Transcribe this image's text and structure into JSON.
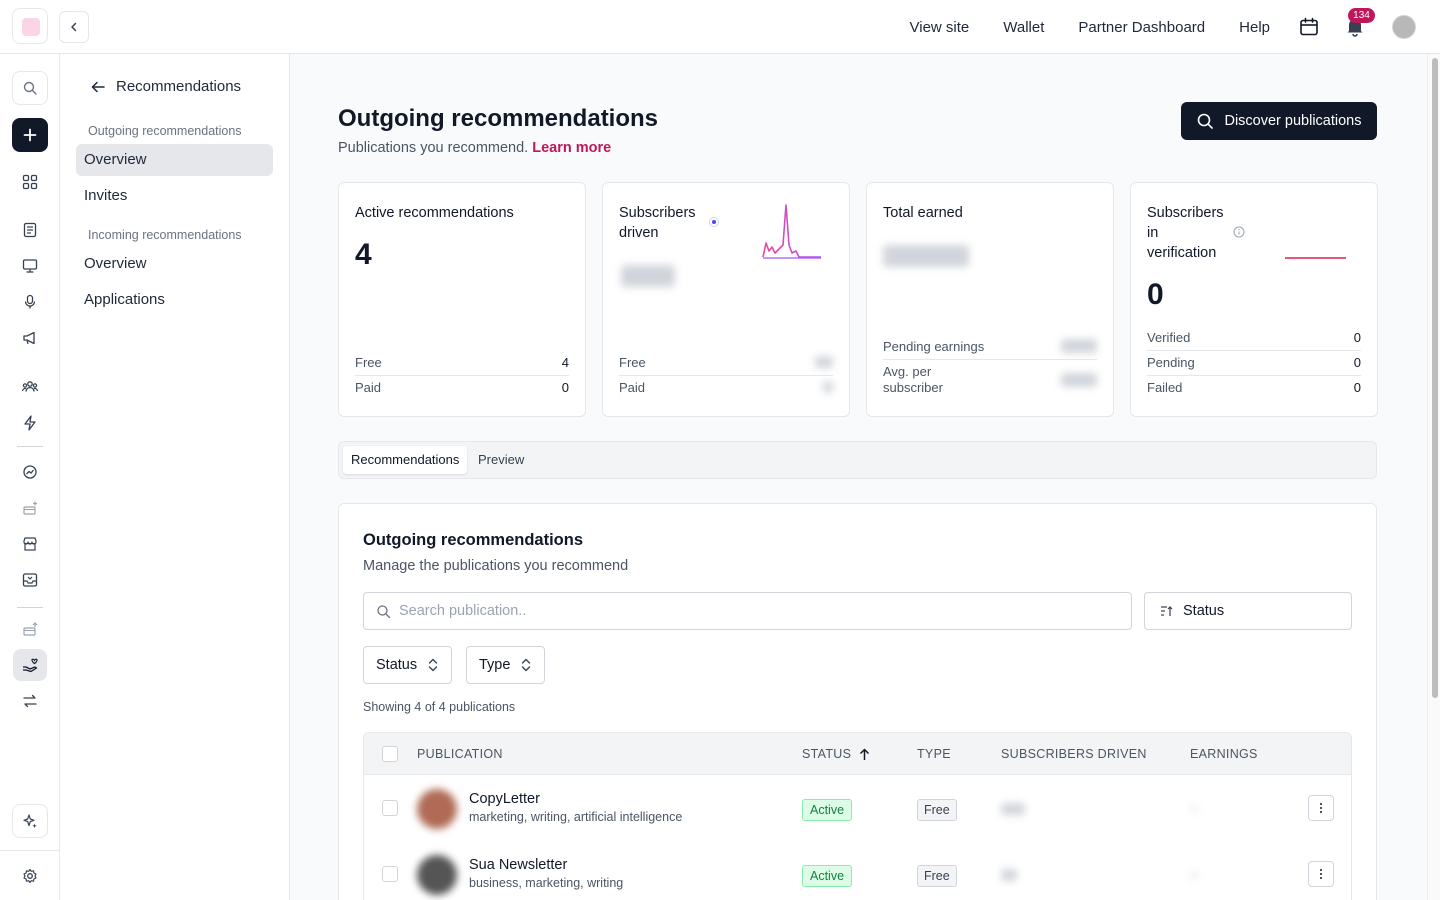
{
  "topbar": {
    "nav": [
      "View site",
      "Wallet",
      "Partner Dashboard",
      "Help"
    ],
    "notification_count": "134"
  },
  "subnav": {
    "back_label": "Recommendations",
    "outgoing_group": "Outgoing recommendations",
    "outgoing_items": [
      "Overview",
      "Invites"
    ],
    "incoming_group": "Incoming recommendations",
    "incoming_items": [
      "Overview",
      "Applications"
    ]
  },
  "page": {
    "title": "Outgoing recommendations",
    "subtitle": "Publications you recommend.",
    "learn_more": "Learn more",
    "discover_button": "Discover publications"
  },
  "cards": {
    "active": {
      "title": "Active recommendations",
      "value": "4",
      "rows": [
        {
          "label": "Free",
          "value": "4"
        },
        {
          "label": "Paid",
          "value": "0"
        }
      ]
    },
    "driven": {
      "title": "Subscribers driven",
      "rows": [
        {
          "label": "Free"
        },
        {
          "label": "Paid"
        }
      ]
    },
    "earned": {
      "title": "Total earned",
      "rows": [
        {
          "label": "Pending earnings"
        },
        {
          "label": "Avg. per subscriber"
        }
      ]
    },
    "verification": {
      "title": "Subscribers in verification",
      "value": "0",
      "rows": [
        {
          "label": "Verified",
          "value": "0"
        },
        {
          "label": "Pending",
          "value": "0"
        },
        {
          "label": "Failed",
          "value": "0"
        }
      ]
    }
  },
  "tabs": [
    "Recommendations",
    "Preview"
  ],
  "panel": {
    "title": "Outgoing recommendations",
    "subtitle": "Manage the publications you recommend",
    "search_placeholder": "Search publication..",
    "sort_label": "Status",
    "filters": [
      "Status",
      "Type"
    ],
    "showing": "Showing 4 of 4 publications"
  },
  "table": {
    "columns": [
      "PUBLICATION",
      "STATUS",
      "TYPE",
      "SUBSCRIBERS DRIVEN",
      "EARNINGS"
    ],
    "rows": [
      {
        "name": "CopyLetter",
        "tags": "marketing, writing, artificial intelligence",
        "status": "Active",
        "type": "Free",
        "avatar_color": "#b06a55"
      },
      {
        "name": "Sua Newsletter",
        "tags": "business, marketing, writing",
        "status": "Active",
        "type": "Free",
        "avatar_color": "#555555"
      }
    ]
  },
  "colors": {
    "accent": "#be185d",
    "primary_button": "#111827",
    "success": "#15803d"
  }
}
